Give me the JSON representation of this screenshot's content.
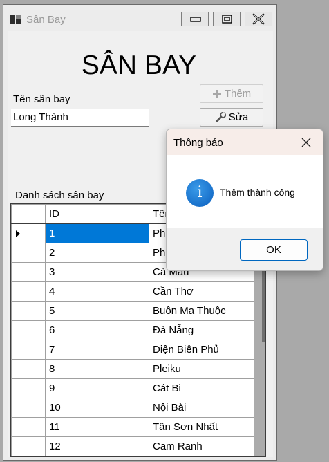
{
  "window": {
    "title": "Sân Bay"
  },
  "form": {
    "heading": "SÂN BAY",
    "name_label": "Tên sân bay",
    "name_value": "Long Thành",
    "add_label": "Thêm",
    "edit_label": "Sửa",
    "list_label": "Danh sách sân bay"
  },
  "grid": {
    "columns": [
      "ID",
      "Tên"
    ],
    "rows": [
      {
        "id": "1",
        "name": "Phú Quốc"
      },
      {
        "id": "2",
        "name": "Phú Bài"
      },
      {
        "id": "3",
        "name": "Cà Mau"
      },
      {
        "id": "4",
        "name": "Cần Thơ"
      },
      {
        "id": "5",
        "name": "Buôn Ma Thuộc"
      },
      {
        "id": "6",
        "name": "Đà Nẵng"
      },
      {
        "id": "7",
        "name": "Điện Biên Phủ"
      },
      {
        "id": "8",
        "name": "Pleiku"
      },
      {
        "id": "9",
        "name": "Cát Bi"
      },
      {
        "id": "10",
        "name": "Nội Bài"
      },
      {
        "id": "11",
        "name": "Tân Sơn Nhất"
      },
      {
        "id": "12",
        "name": "Cam Ranh"
      }
    ],
    "selected_row": 0
  },
  "dialog": {
    "title": "Thông báo",
    "message": "Thêm thành công",
    "ok_label": "OK",
    "icon": "info-icon"
  },
  "colors": {
    "selection": "#0078d7",
    "accent_border": "#0067c0",
    "dialog_title_bg": "#f7ede9"
  }
}
